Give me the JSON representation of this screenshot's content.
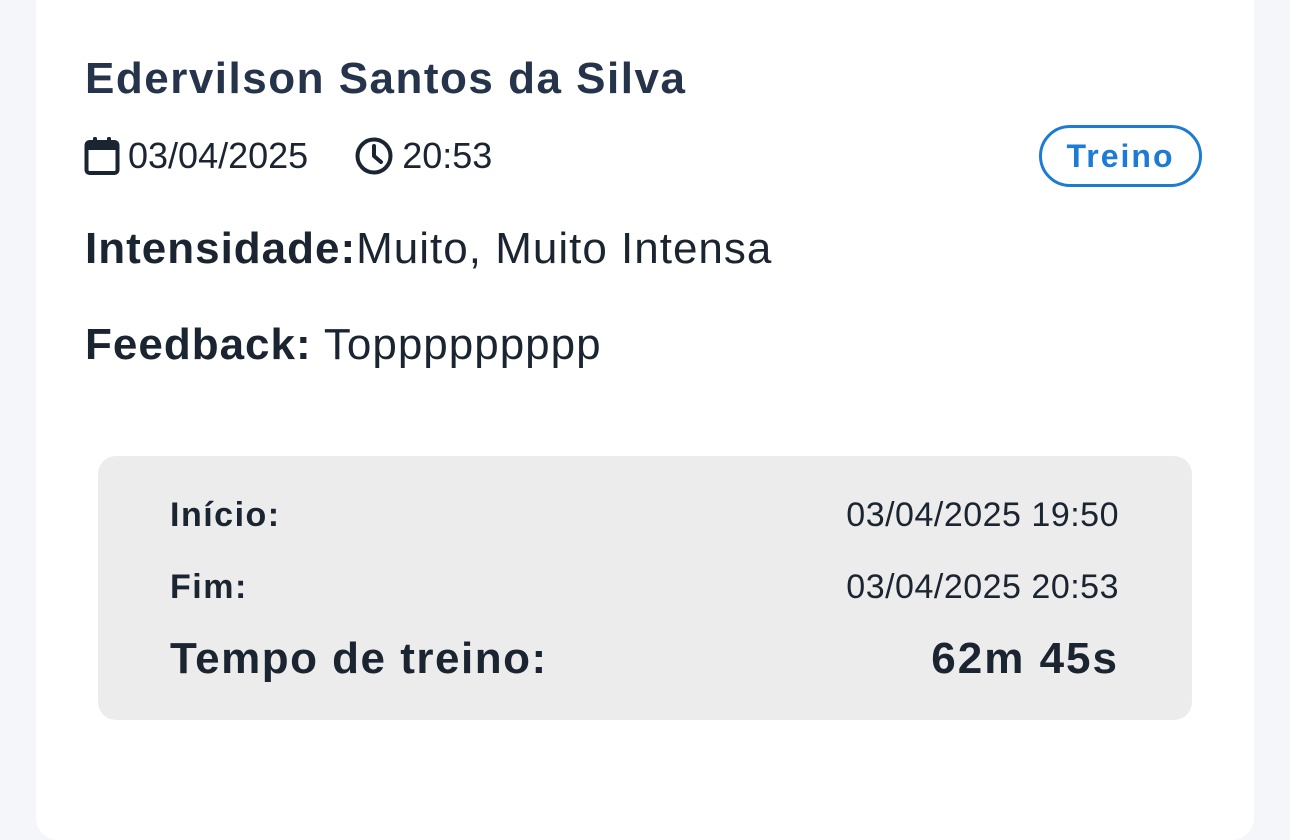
{
  "record": {
    "athlete_name": "Edervilson Santos da Silva",
    "date": "03/04/2025",
    "time": "20:53",
    "type_badge": "Treino",
    "intensity_label": "Intensidade:",
    "intensity_value": "Muito, Muito Intensa",
    "feedback_label": "Feedback:",
    "feedback_value": "Toppppppppp",
    "icons": {
      "date": "calendar-icon",
      "time": "clock-icon"
    }
  },
  "summary": {
    "start_label": "Início:",
    "start_value": "03/04/2025 19:50",
    "end_label": "Fim:",
    "end_value": "03/04/2025 20:53",
    "duration_label": "Tempo de treino:",
    "duration_value": "62m 45s"
  },
  "colors": {
    "accent": "#1c7bd3",
    "title": "#26344b",
    "text": "#1b2431",
    "summary_background": "#ececec",
    "page_background": "#f5f6fa"
  }
}
